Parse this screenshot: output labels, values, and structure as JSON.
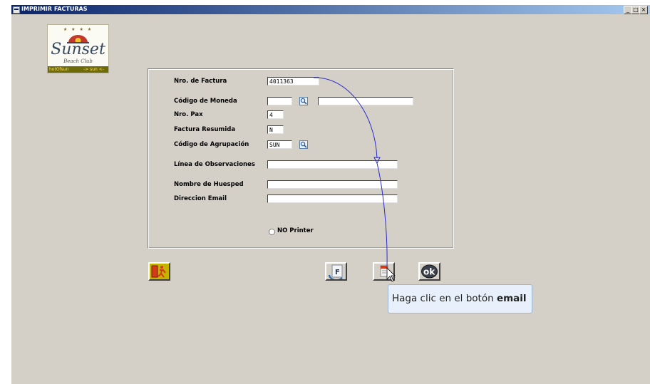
{
  "window": {
    "title": "IMPRIMIR FACTURAS",
    "min_glyph": "_",
    "max_glyph": "□",
    "close_glyph": "×"
  },
  "logo": {
    "stars": "★ ★ ★ ★",
    "script": "Sunset",
    "sub": "Beach Club",
    "bar_left": "hotOfsun",
    "bar_right": "-> sun <-"
  },
  "form": {
    "factura": {
      "label": "Nro. de Factura",
      "value": "4011363"
    },
    "moneda": {
      "label": "Código de Moneda",
      "value": "",
      "desc": ""
    },
    "pax": {
      "label": "Nro. Pax",
      "value": "4"
    },
    "resumida": {
      "label": "Factura Resumida",
      "value": "N"
    },
    "agrupacion": {
      "label": "Código de Agrupación",
      "value": "SUN"
    },
    "observaciones": {
      "label": "Línea de Observaciones",
      "value": ""
    },
    "huesped": {
      "label": "Nombre de Huesped",
      "value": ""
    },
    "email": {
      "label": "Direccion Email",
      "value": ""
    },
    "printer_option": {
      "label": "NO Printer"
    }
  },
  "toolbar": {
    "f_label": "F",
    "ok_label": "ok"
  },
  "tooltip": {
    "prefix": "Haga clic en el botón ",
    "bold": "email"
  },
  "icons": [
    "window-icon",
    "lookup-icon",
    "exit-icon",
    "f-document-icon",
    "email-icon",
    "ok-icon",
    "cursor-icon"
  ]
}
